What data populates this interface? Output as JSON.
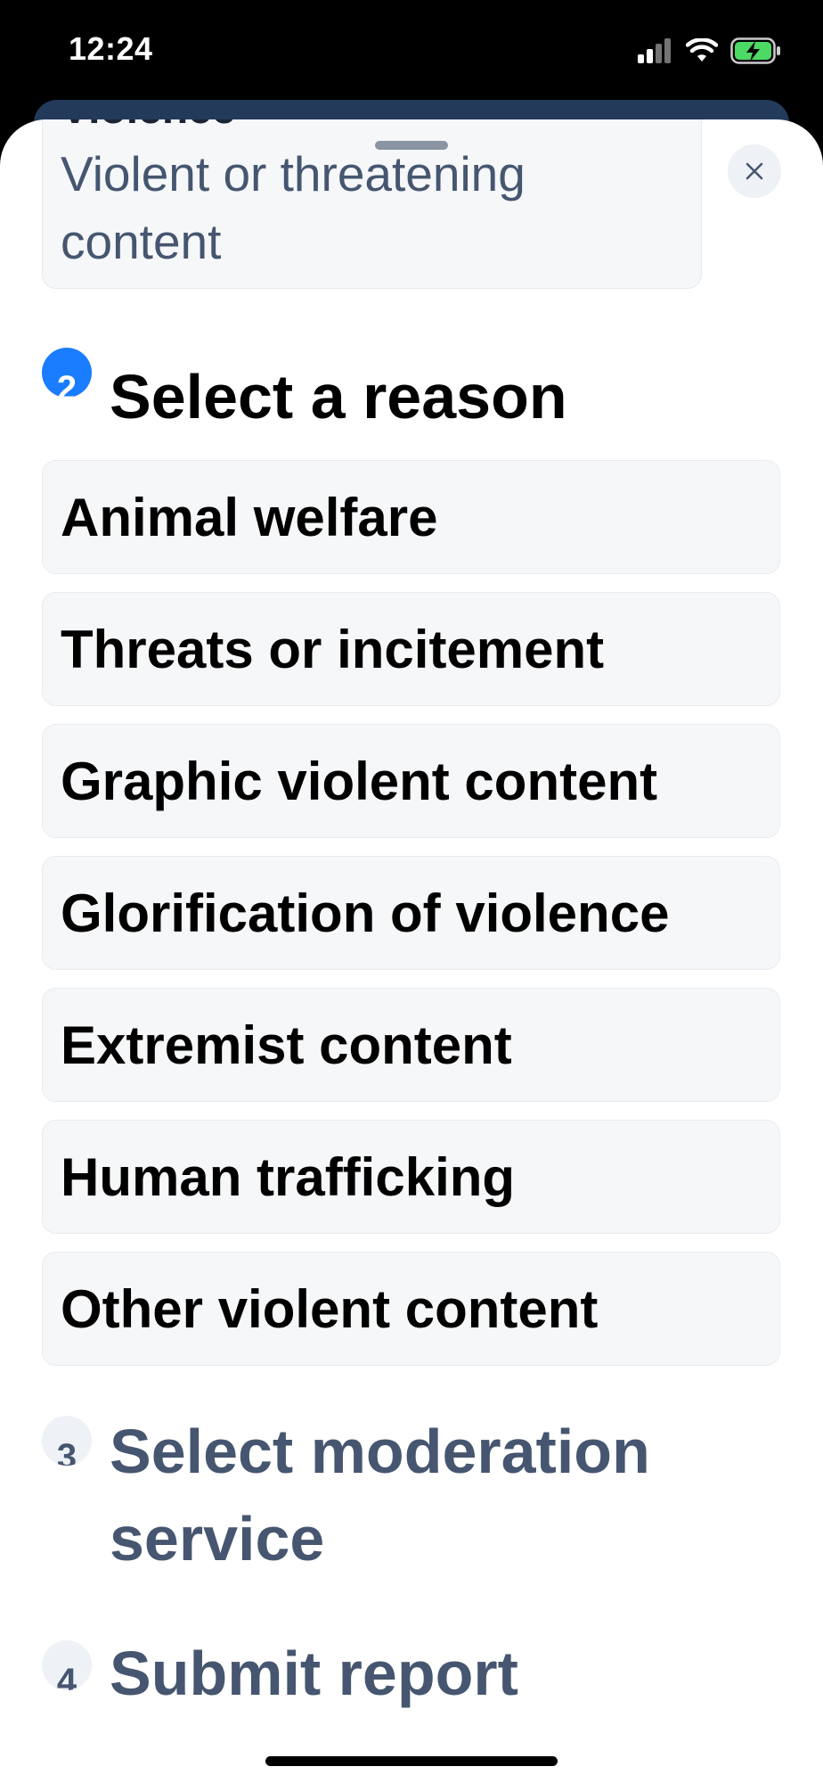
{
  "status_bar": {
    "time": "12:24"
  },
  "category": {
    "title": "Violence",
    "description": "Violent or threatening content"
  },
  "steps": {
    "step2": {
      "number": "2",
      "title": "Select a reason"
    },
    "step3": {
      "number": "3",
      "title": "Select moderation service"
    },
    "step4": {
      "number": "4",
      "title": "Submit report"
    }
  },
  "reasons": [
    "Animal welfare",
    "Threats or incitement",
    "Graphic violent content",
    "Glorification of violence",
    "Extremist content",
    "Human trafficking",
    "Other violent content"
  ],
  "colors": {
    "accent": "#1a7cff",
    "muted_text": "#465670",
    "card_bg": "#f6f7f9"
  },
  "icons": [
    "signal-icon",
    "wifi-icon",
    "battery-charging-icon",
    "close-icon"
  ]
}
